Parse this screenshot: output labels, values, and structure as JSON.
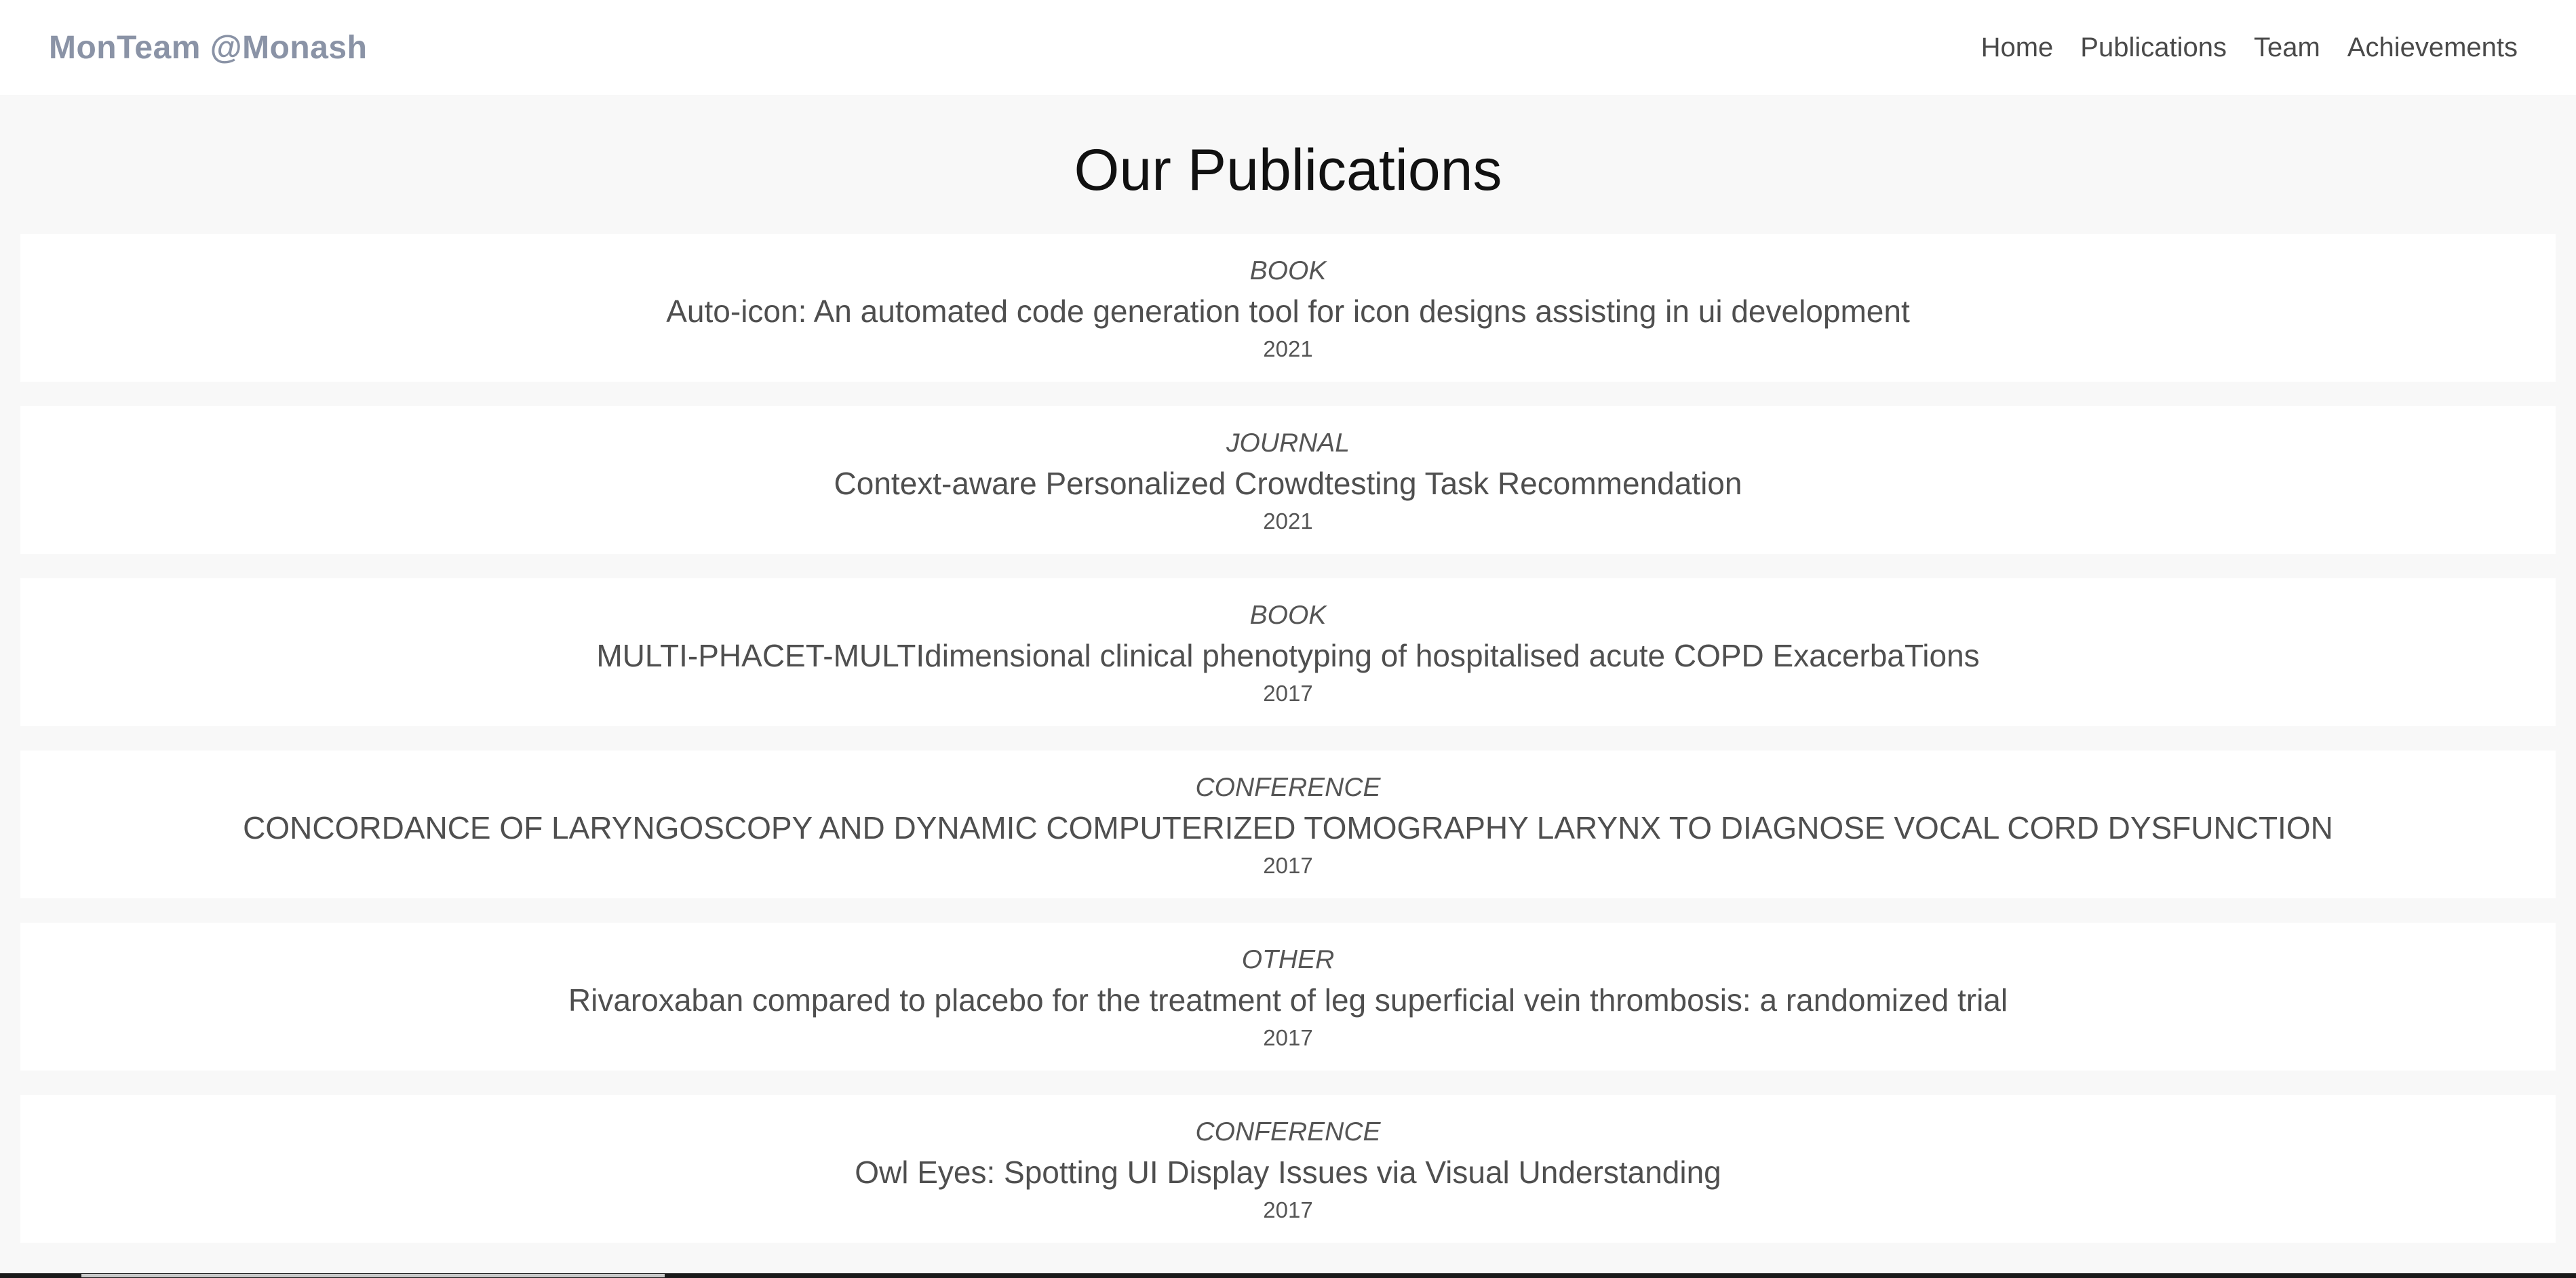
{
  "navbar": {
    "brand": "MonTeam @Monash",
    "links": [
      {
        "label": "Home"
      },
      {
        "label": "Publications"
      },
      {
        "label": "Team"
      },
      {
        "label": "Achievements"
      }
    ]
  },
  "main": {
    "title": "Our Publications",
    "publications": [
      {
        "type": "BOOK",
        "title": "Auto-icon: An automated code generation tool for icon designs assisting in ui development",
        "year": "2021"
      },
      {
        "type": "JOURNAL",
        "title": "Context-aware Personalized Crowdtesting Task Recommendation",
        "year": "2021"
      },
      {
        "type": "BOOK",
        "title": "MULTI-PHACET-MULTIdimensional clinical phenotyping of hospitalised acute COPD ExacerbaTions",
        "year": "2017"
      },
      {
        "type": "CONFERENCE",
        "title": "CONCORDANCE OF LARYNGOSCOPY AND DYNAMIC COMPUTERIZED TOMOGRAPHY LARYNX TO DIAGNOSE VOCAL CORD DYSFUNCTION",
        "year": "2017"
      },
      {
        "type": "OTHER",
        "title": "Rivaroxaban compared to placebo for the treatment of leg superficial vein thrombosis: a randomized trial",
        "year": "2017"
      },
      {
        "type": "CONFERENCE",
        "title": "Owl Eyes: Spotting UI Display Issues via Visual Understanding",
        "year": "2017"
      }
    ]
  },
  "colors": {
    "brand": "#8a93a6",
    "page_background": "#f8f8f8",
    "card_background": "#ffffff",
    "text": "#4f4f4f"
  }
}
